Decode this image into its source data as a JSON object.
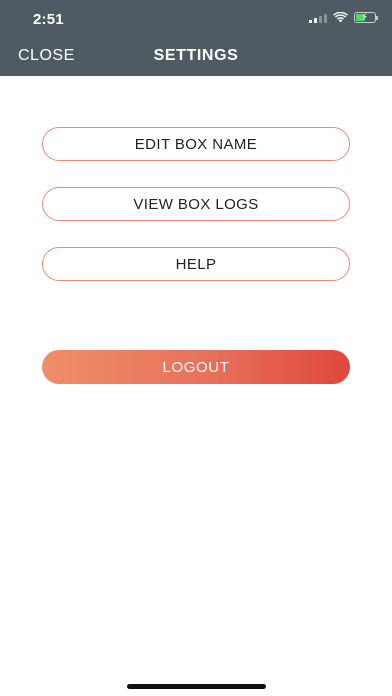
{
  "status_bar": {
    "time": "2:51",
    "icons": [
      "signal-icon",
      "wifi-icon",
      "battery-charging-icon"
    ],
    "battery_fill": 0.5
  },
  "header": {
    "close_label": "CLOSE",
    "title": "SETTINGS"
  },
  "menu": {
    "items": [
      {
        "label": "EDIT BOX NAME"
      },
      {
        "label": "VIEW BOX LOGS"
      },
      {
        "label": "HELP"
      }
    ]
  },
  "logout": {
    "label": "LOGOUT"
  },
  "colors": {
    "header_bg": "#4e5b63",
    "button_border": "#ec8b72",
    "logout_gradient_start": "#ef8e68",
    "logout_gradient_end": "#e0473b",
    "battery_green": "#4cd964"
  }
}
